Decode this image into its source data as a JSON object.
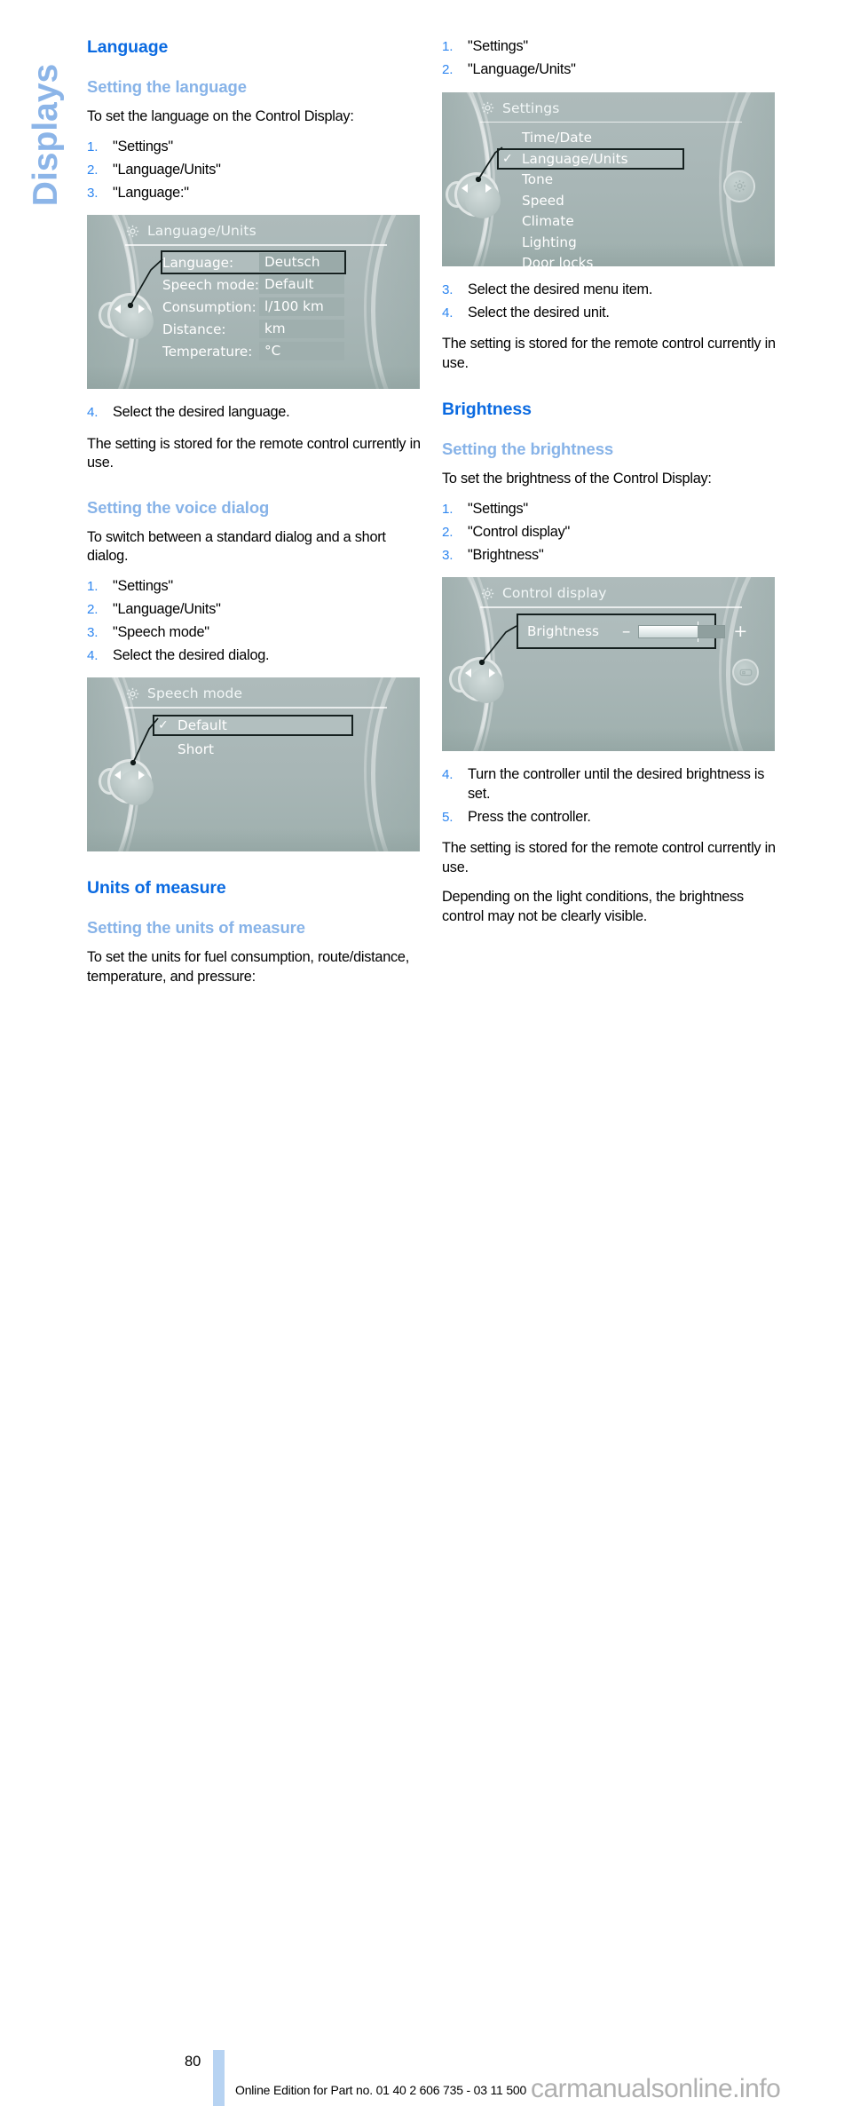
{
  "chapter_tab": {
    "label": "Displays"
  },
  "left_column": {
    "heading": "Language",
    "sub1": "Setting the language",
    "intro1": "To set the language on the Control Display:",
    "steps1": [
      {
        "num": "1.",
        "text": "\"Settings\""
      },
      {
        "num": "2.",
        "text": "\"Language/Units\""
      },
      {
        "num": "3.",
        "text": "\"Language:\""
      }
    ],
    "figure1": {
      "title": "Language/Units",
      "icon": "gear-icon",
      "rows": [
        {
          "key": "Language:",
          "value": "Deutsch",
          "selected": true
        },
        {
          "key": "Speech mode:",
          "value": "Default",
          "selected": false
        },
        {
          "key": "Consumption:",
          "value": "l/100 km",
          "selected": false
        },
        {
          "key": "Distance:",
          "value": "km",
          "selected": false
        },
        {
          "key": "Temperature:",
          "value": "°C",
          "selected": false
        }
      ]
    },
    "steps2": [
      {
        "num": "4.",
        "text": "Select the desired language."
      }
    ],
    "note1": "The setting is stored for the remote control currently in use.",
    "sub2": "Setting the voice dialog",
    "intro2": "To switch between a standard dialog and a short dialog.",
    "steps3": [
      {
        "num": "1.",
        "text": "\"Settings\""
      },
      {
        "num": "2.",
        "text": "\"Language/Units\""
      },
      {
        "num": "3.",
        "text": "\"Speech mode\""
      },
      {
        "num": "4.",
        "text": "Select the desired dialog."
      }
    ],
    "figure2": {
      "title": "Speech mode",
      "icon": "gear-icon",
      "items": [
        {
          "label": "Default",
          "checked": true,
          "selected": true
        },
        {
          "label": "Short",
          "checked": false,
          "selected": false
        }
      ]
    },
    "heading2": "Units of measure",
    "sub3": "Setting the units of measure",
    "intro3": "To set the units for fuel consumption, route/distance, temperature, and pressure:"
  },
  "right_column": {
    "steps1": [
      {
        "num": "1.",
        "text": "\"Settings\""
      },
      {
        "num": "2.",
        "text": "\"Language/Units\""
      }
    ],
    "figure1": {
      "title": "Settings",
      "icon": "gear-icon",
      "items": [
        {
          "label": "Time/Date",
          "checked": false,
          "selected": false
        },
        {
          "label": "Language/Units",
          "checked": true,
          "selected": true
        },
        {
          "label": "Tone",
          "checked": false,
          "selected": false
        },
        {
          "label": "Speed",
          "checked": false,
          "selected": false
        },
        {
          "label": "Climate",
          "checked": false,
          "selected": false
        },
        {
          "label": "Lighting",
          "checked": false,
          "selected": false
        },
        {
          "label": "Door locks",
          "checked": false,
          "selected": false
        }
      ]
    },
    "steps2": [
      {
        "num": "3.",
        "text": "Select the desired menu item."
      },
      {
        "num": "4.",
        "text": "Select the desired unit."
      }
    ],
    "note1": "The setting is stored for the remote control currently in use.",
    "heading": "Brightness",
    "sub1": "Setting the brightness",
    "intro1": "To set the brightness of the Control Display:",
    "steps3": [
      {
        "num": "1.",
        "text": "\"Settings\""
      },
      {
        "num": "2.",
        "text": "\"Control display\""
      },
      {
        "num": "3.",
        "text": "\"Brightness\""
      }
    ],
    "figure2": {
      "title": "Control display",
      "icon": "gear-icon",
      "label": "Brightness",
      "minus": "–",
      "plus": "+",
      "fill_percent": 68
    },
    "steps4": [
      {
        "num": "4.",
        "text": "Turn the controller until the desired brightness is set."
      },
      {
        "num": "5.",
        "text": "Press the controller."
      }
    ],
    "note2": "The setting is stored for the remote control currently in use.",
    "note3": "Depending on the light conditions, the brightness control may not be clearly visible."
  },
  "footer": {
    "page_number": "80",
    "text": "Online Edition for Part no. 01 40 2 606 735 - 03 11 500",
    "watermark": "carmanualsonline.info"
  },
  "colors": {
    "heading_blue": "#0a6ae1",
    "subheading_blue": "#87b3e8",
    "step_number_blue": "#2e86f0",
    "tab_blue": "#8cb5e8",
    "page_bar_blue": "#b7d3f2",
    "display_bg": "#a9b7b7",
    "display_text": "#ffffff",
    "selection_border": "#15201f"
  }
}
